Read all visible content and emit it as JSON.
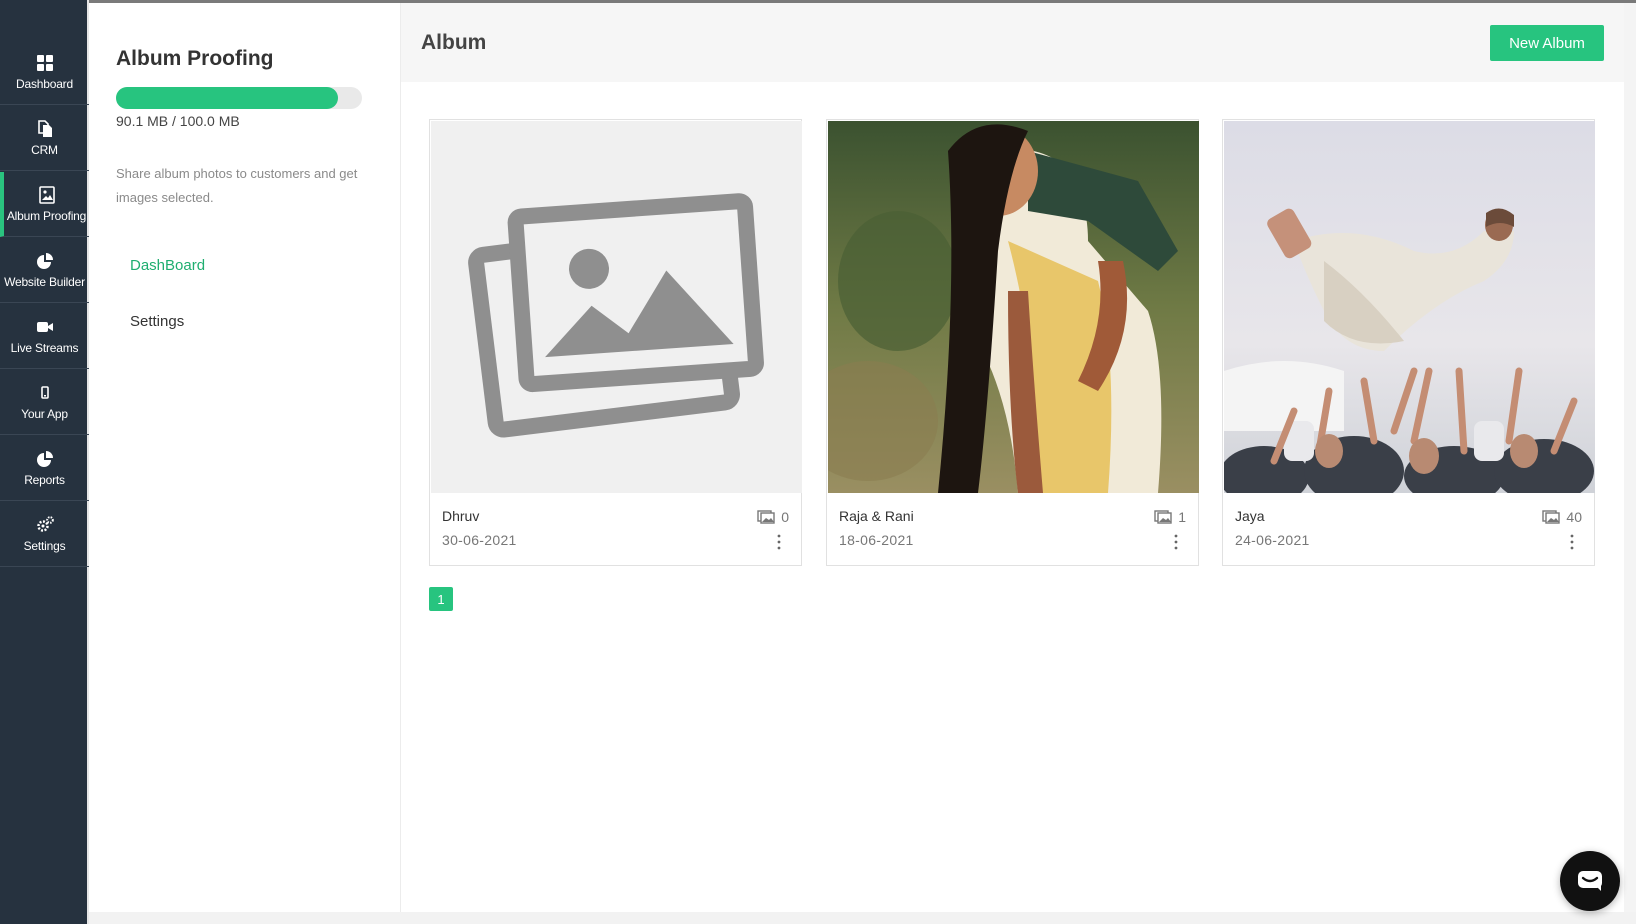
{
  "nav": {
    "items": [
      {
        "label": "Dashboard",
        "icon": "grid-icon"
      },
      {
        "label": "CRM",
        "icon": "documents-icon"
      },
      {
        "label": "Album Proofing",
        "icon": "image-icon"
      },
      {
        "label": "Website Builder",
        "icon": "pie-chart-icon"
      },
      {
        "label": "Live Streams",
        "icon": "video-camera-icon"
      },
      {
        "label": "Your App",
        "icon": "mobile-icon"
      },
      {
        "label": "Reports",
        "icon": "pie-chart-icon"
      },
      {
        "label": "Settings",
        "icon": "gears-icon"
      }
    ],
    "active": "Album Proofing"
  },
  "sidebar": {
    "title": "Album Proofing",
    "storage": {
      "used_fraction": 0.901,
      "text": "90.1 MB / 100.0 MB"
    },
    "description": "Share album photos to customers and get images selected.",
    "links": [
      {
        "label": "DashBoard",
        "active": true
      },
      {
        "label": "Settings",
        "active": false
      }
    ]
  },
  "header": {
    "title": "Album",
    "new_button": "New Album"
  },
  "albums": [
    {
      "name": "Dhruv",
      "date": "30-06-2021",
      "count": "0",
      "cover": "placeholder-image-icon"
    },
    {
      "name": "Raja & Rani",
      "date": "18-06-2021",
      "count": "1",
      "cover": "photo-woman-in-saree"
    },
    {
      "name": "Jaya",
      "date": "24-06-2021",
      "count": "40",
      "cover": "photo-bride-tossed-in-air"
    }
  ],
  "pagination": {
    "current": "1"
  },
  "colors": {
    "accent": "#27c47f",
    "rail": "#26323f",
    "active_link": "#1fae70"
  }
}
